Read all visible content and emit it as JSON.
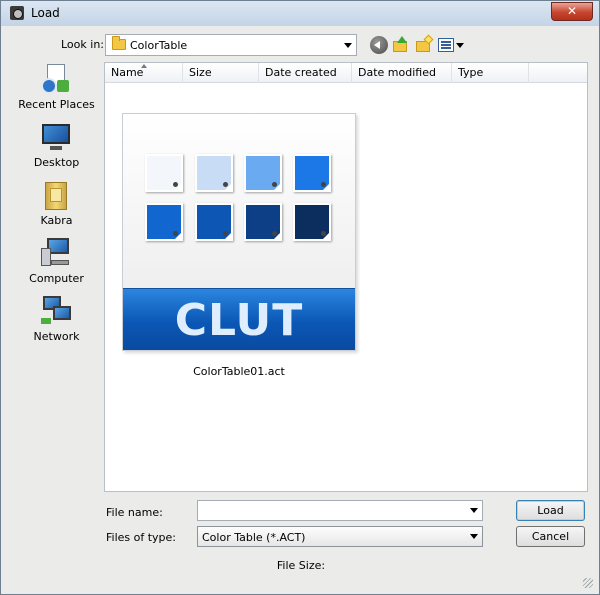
{
  "window": {
    "title": "Load",
    "close_glyph": "✕"
  },
  "toolbar": {
    "look_in_label": "Look in:",
    "look_in_value": "ColorTable"
  },
  "places": [
    {
      "label": "Recent Places",
      "icon": "recent-places-icon"
    },
    {
      "label": "Desktop",
      "icon": "desktop-icon"
    },
    {
      "label": "Kabra",
      "icon": "user-folder-icon"
    },
    {
      "label": "Computer",
      "icon": "computer-icon"
    },
    {
      "label": "Network",
      "icon": "network-icon"
    }
  ],
  "columns": [
    "Name",
    "Size",
    "Date created",
    "Date modified",
    "Type"
  ],
  "files": [
    {
      "name": "ColorTable01.act",
      "thumbnail_text": "CLUT"
    }
  ],
  "swatch_colors": [
    "#f3f6fb",
    "#c9dcf6",
    "#6aaaf0",
    "#1b78e6",
    "#1166cf",
    "#0d56b3",
    "#0c3f86",
    "#0b2e5e"
  ],
  "bottom": {
    "file_name_label": "File name:",
    "file_name_value": "",
    "file_type_label": "Files of type:",
    "file_type_value": "Color Table (*.ACT)",
    "load_label": "Load",
    "cancel_label": "Cancel",
    "file_size_label": "File Size:"
  }
}
